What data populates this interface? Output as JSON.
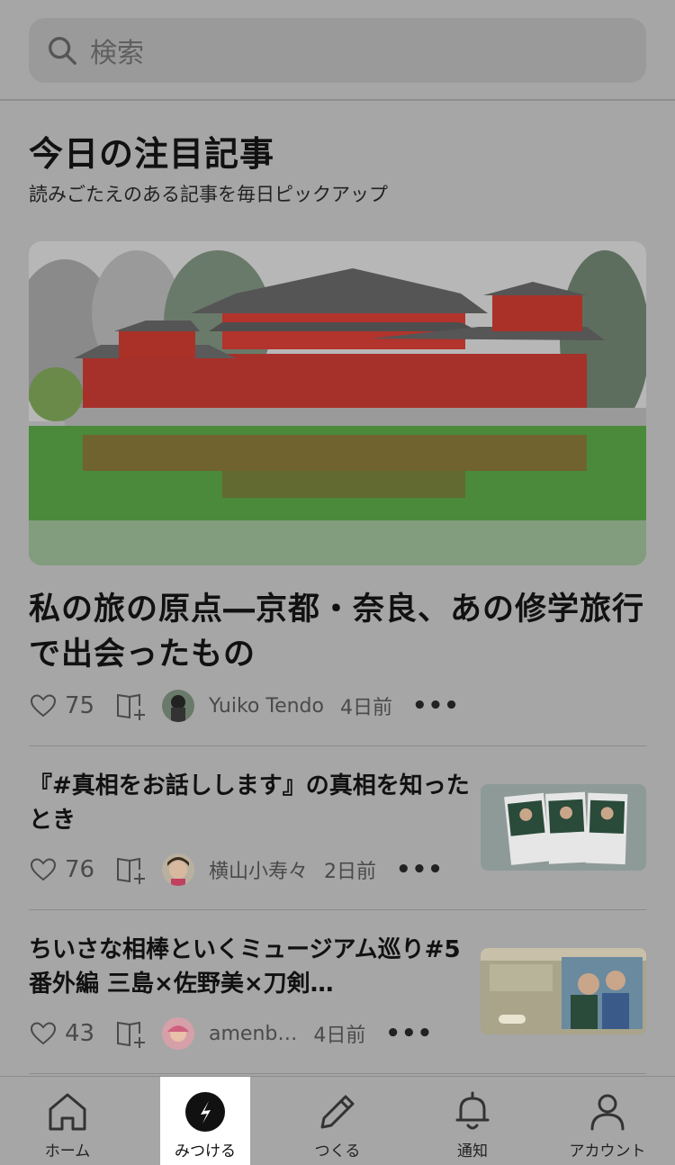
{
  "search": {
    "placeholder": "検索"
  },
  "section": {
    "title": "今日の注目記事",
    "subtitle": "読みごたえのある記事を毎日ピックアップ"
  },
  "featured": {
    "title": "私の旅の原点―京都・奈良、あの修学旅行で出会ったもの",
    "likes": "75",
    "author": "Yuiko Tendo",
    "time": "4日前",
    "more": "•••"
  },
  "articles": [
    {
      "title": "『#真相をお話しします』の真相を知ったとき",
      "likes": "76",
      "author": "横山小寿々",
      "time": "2日前",
      "more": "•••"
    },
    {
      "title": "ちいさな相棒といくミュージアム巡り#5 番外編 三島×佐野美×刀剣…",
      "likes": "43",
      "author": "amenb…",
      "time": "4日前",
      "more": "•••"
    }
  ],
  "tabs": [
    {
      "label": "ホーム",
      "icon": "home-icon"
    },
    {
      "label": "みつける",
      "icon": "compass-icon"
    },
    {
      "label": "つくる",
      "icon": "pencil-icon"
    },
    {
      "label": "通知",
      "icon": "bell-icon"
    },
    {
      "label": "アカウント",
      "icon": "person-icon"
    }
  ]
}
